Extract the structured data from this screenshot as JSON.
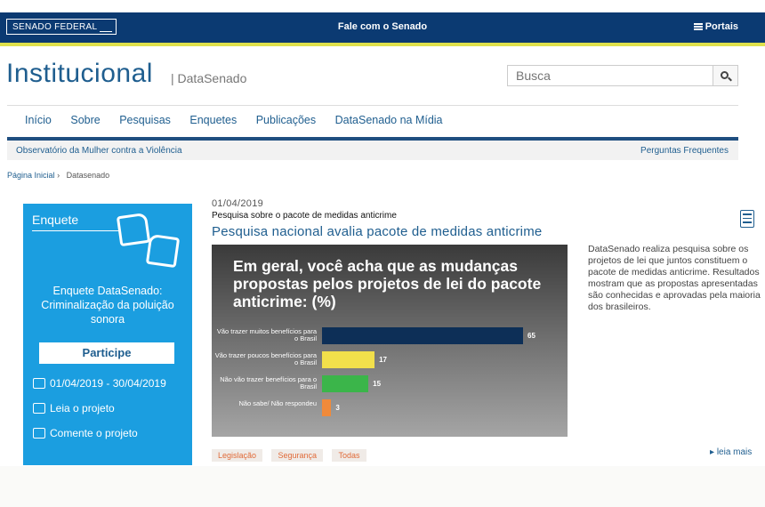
{
  "topbar": {
    "logo": "SENADO FEDERAL",
    "center_link": "Fale com o Senado",
    "portais": "Portais"
  },
  "header": {
    "title": "Institucional",
    "subtitle": "| DataSenado",
    "search_placeholder": "Busca"
  },
  "nav": {
    "items": [
      "Início",
      "Sobre",
      "Pesquisas",
      "Enquetes",
      "Publicações",
      "DataSenado na Mídia"
    ]
  },
  "subnav": {
    "left": "Observatório da Mulher contra a Violência",
    "right": "Perguntas Frequentes"
  },
  "breadcrumb": {
    "home": "Página Inicial",
    "sep": "›",
    "current": "Datasenado"
  },
  "panel": {
    "heading": "Enquete",
    "title": "Enquete DataSenado: Criminalização da poluição sonora",
    "button": "Participe",
    "dates": "01/04/2019 - 30/04/2019",
    "read": "Leia o projeto",
    "comment": "Comente o projeto"
  },
  "article": {
    "date": "01/04/2019",
    "kicker": "Pesquisa sobre o pacote de medidas anticrime",
    "headline": "Pesquisa nacional avalia pacote de medidas anticrime",
    "description": "DataSenado realiza pesquisa sobre os projetos de lei que juntos constituem o pacote de medidas anticrime. Resultados mostram que as propostas apresentadas são conhecidas e aprovadas pela maioria dos brasileiros.",
    "tags": [
      "Legislação",
      "Segurança",
      "Todas"
    ],
    "read_more": "leia mais"
  },
  "chart_data": {
    "type": "bar",
    "title": "Em geral, você acha que as mudanças propostas pelos projetos de lei do pacote anticrime: (%)",
    "categories": [
      "Vão trazer muitos benefícios para o Brasil",
      "Vão trazer poucos benefícios para o Brasil",
      "Não vão trazer benefícios para o Brasil",
      "Não sabe/ Não respondeu"
    ],
    "values": [
      65,
      17,
      15,
      3
    ],
    "colors": [
      "#0d2f57",
      "#f2e04b",
      "#3bb54a",
      "#f08a3a"
    ],
    "xlim": [
      0,
      65
    ]
  }
}
